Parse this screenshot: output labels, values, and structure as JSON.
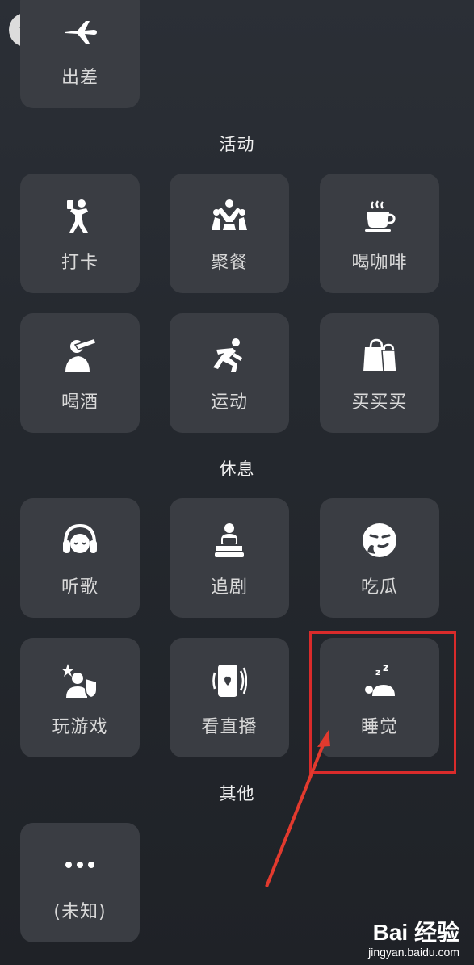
{
  "top_tile": {
    "label": "出差",
    "icon": "airplane-icon"
  },
  "sections": {
    "activity": "活动",
    "rest": "休息",
    "other": "其他"
  },
  "activity_tiles": [
    {
      "label": "打卡",
      "icon": "check-in-pose-icon"
    },
    {
      "label": "聚餐",
      "icon": "dining-group-icon"
    },
    {
      "label": "喝咖啡",
      "icon": "coffee-cup-icon"
    },
    {
      "label": "喝酒",
      "icon": "drinking-icon"
    },
    {
      "label": "运动",
      "icon": "running-icon"
    },
    {
      "label": "买买买",
      "icon": "shopping-bags-icon"
    }
  ],
  "rest_tiles": [
    {
      "label": "听歌",
      "icon": "headphones-icon"
    },
    {
      "label": "追剧",
      "icon": "watching-tv-icon"
    },
    {
      "label": "吃瓜",
      "icon": "smirk-face-icon"
    },
    {
      "label": "玩游戏",
      "icon": "gaming-icon"
    },
    {
      "label": "看直播",
      "icon": "live-stream-icon"
    },
    {
      "label": "睡觉",
      "icon": "sleeping-icon"
    }
  ],
  "other_tiles": [
    {
      "label": "(未知)",
      "icon": "more-dots-icon"
    }
  ],
  "collapse_icon": "chevron-down-icon",
  "colors": {
    "background": "#25292f",
    "tile": "#3a3d43",
    "highlight": "#d92b2b",
    "arrow": "#e23a2e"
  },
  "watermark": {
    "logo": "Bai 经验",
    "url": "jingyan.baidu.com"
  }
}
